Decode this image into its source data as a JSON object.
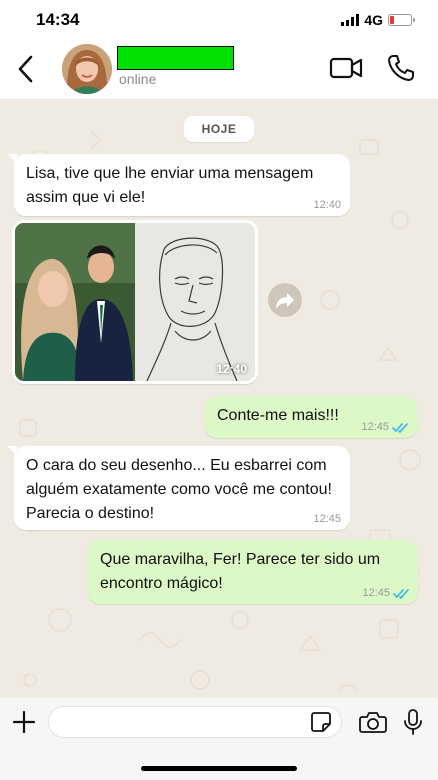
{
  "status_bar": {
    "time": "14:34",
    "network": "4G",
    "battery_level": 0.2,
    "battery_color": "#e53935"
  },
  "header": {
    "contact_name": "",
    "contact_name_redaction_color": "#00e000",
    "status": "online",
    "icons": [
      "back-chevron-icon",
      "video-call-icon",
      "phone-icon"
    ]
  },
  "chat": {
    "wallpaper_color": "#f0ebe2",
    "date_chip": "HOJE",
    "messages": [
      {
        "direction": "in",
        "text": "Lisa, tive que lhe enviar uma mensagem assim que vi ele!",
        "time": "12:40"
      },
      {
        "direction": "in",
        "type": "photo",
        "time": "12:40"
      },
      {
        "direction": "out",
        "text": "Conte-me mais!!!",
        "time": "12:45",
        "status": "read"
      },
      {
        "direction": "in",
        "text": "O cara do seu desenho... Eu esbarrei com alguém exatamente como você me contou! Parecia o destino!",
        "time": "12:45"
      },
      {
        "direction": "out",
        "text": "Que maravilha, Fer! Parece ter sido um encontro mágico!",
        "time": "12:45",
        "status": "read"
      }
    ],
    "outgoing_bubble_color": "#dcf8c6",
    "read_ticks_color": "#34b7f1"
  },
  "input_bar": {
    "placeholder": "",
    "icons": [
      "plus-icon",
      "sticker-icon",
      "camera-icon",
      "microphone-icon"
    ]
  }
}
